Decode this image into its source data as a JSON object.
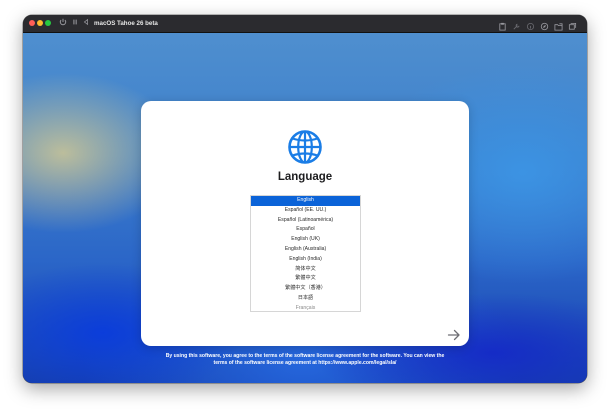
{
  "window": {
    "title": "macOS Tahoe 26 beta"
  },
  "setup": {
    "heading": "Language",
    "languages": [
      "English",
      "Español (EE. UU.)",
      "Español (Latinoamérica)",
      "Español",
      "English (UK)",
      "English (Australia)",
      "English (India)",
      "简体中文",
      "繁體中文",
      "繁體中文（香港）",
      "日本語",
      "Français"
    ],
    "selected_language": "English",
    "license_line1": "By using this software, you agree to the terms of the software license agreement for the software. You can view the",
    "license_line2": "terms of the software license agreement at https://www.apple.com/legal/sla/"
  },
  "icons": {
    "globe": "globe-icon",
    "next": "arrow-right-icon",
    "accent": "#1a7de6",
    "selection": "#0b63d8"
  }
}
